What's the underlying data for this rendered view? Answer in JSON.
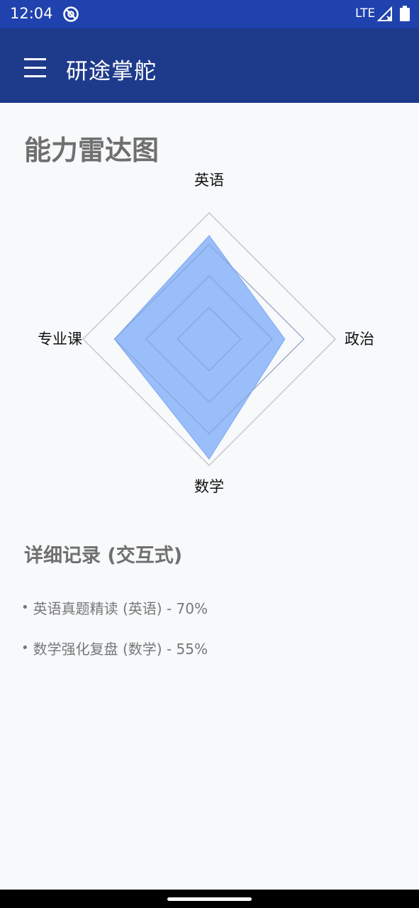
{
  "status_bar": {
    "time": "12:04",
    "network": "LTE"
  },
  "app_bar": {
    "title": "研途掌舵"
  },
  "radar": {
    "title": "能力雷达图",
    "fill_color": "#8ab4f8",
    "grid_color": "#c4c7ce"
  },
  "chart_data": {
    "type": "radar",
    "axes": [
      "英语",
      "政治",
      "数学",
      "专业课"
    ],
    "values": [
      0.82,
      0.6,
      0.95,
      0.75
    ],
    "max": 1,
    "rings": 4
  },
  "details": {
    "title": "详细记录 (交互式)",
    "records": [
      {
        "text": "英语真题精读 (英语) - 70%"
      },
      {
        "text": "数学强化复盘 (数学) - 55%"
      }
    ]
  }
}
